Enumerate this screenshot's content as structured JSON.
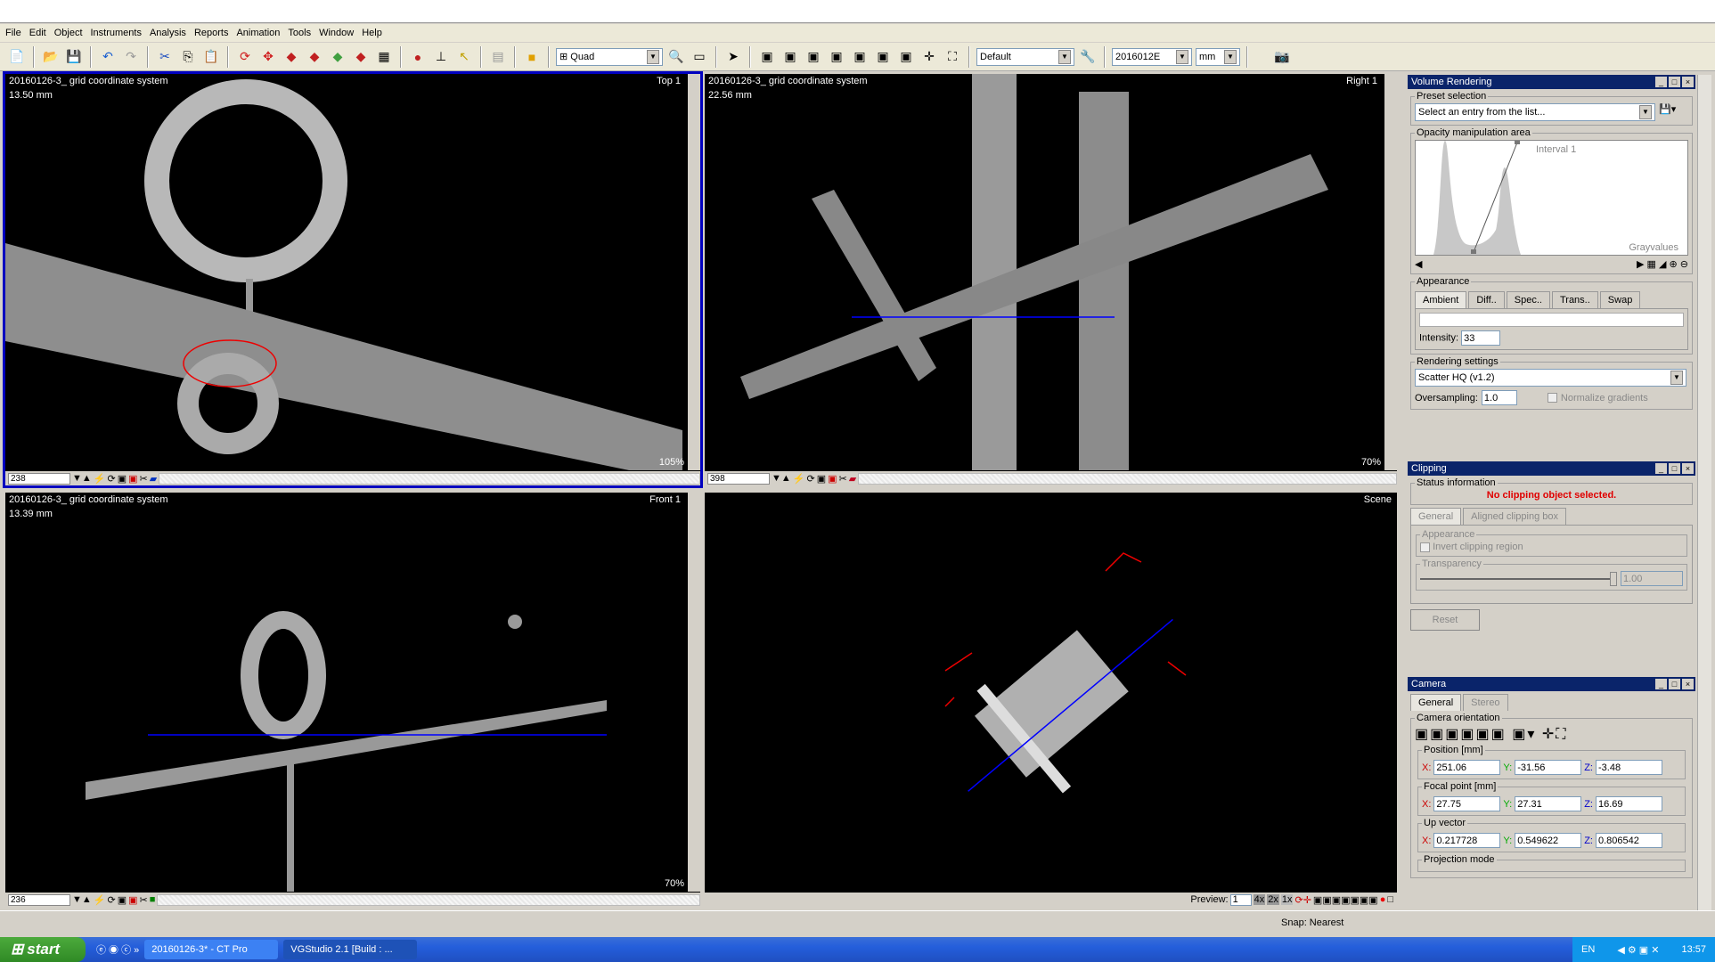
{
  "menu": [
    "File",
    "Edit",
    "Object",
    "Instruments",
    "Analysis",
    "Reports",
    "Animation",
    "Tools",
    "Window",
    "Help"
  ],
  "toolbar": {
    "layout_combo": "Quad",
    "preset_combo": "Default",
    "dataset_combo": "2016012E",
    "unit_combo": "mm"
  },
  "viewports": {
    "top": {
      "title": "20160126-3_ grid coordinate system",
      "scale": "13.50 mm",
      "name": "Top 1",
      "zoom": "105%",
      "slice": "238"
    },
    "right": {
      "title": "20160126-3_ grid coordinate system",
      "scale": "22.56 mm",
      "name": "Right 1",
      "zoom": "70%",
      "slice": "398"
    },
    "front": {
      "title": "20160126-3_ grid coordinate system",
      "scale": "13.39 mm",
      "name": "Front 1",
      "zoom": "70%",
      "slice": "236"
    },
    "scene": {
      "name": "Scene",
      "preview_label": "Preview:",
      "preview_value": "1",
      "scales": [
        "4x",
        "2x",
        "1x"
      ]
    }
  },
  "volume_rendering": {
    "title": "Volume Rendering",
    "preset_label": "Preset selection",
    "preset_placeholder": "Select an entry from the list...",
    "opacity_label": "Opacity manipulation area",
    "interval": "Interval 1",
    "axis": "Grayvalues",
    "appearance_label": "Appearance",
    "tabs": [
      "Ambient",
      "Diff..",
      "Spec..",
      "Trans..",
      "Swap"
    ],
    "intensity_label": "Intensity:",
    "intensity": "33",
    "rendering_label": "Rendering settings",
    "rendering_mode": "Scatter HQ (v1.2)",
    "oversampling_label": "Oversampling:",
    "oversampling": "1.0",
    "normalize_label": "Normalize gradients"
  },
  "clipping": {
    "title": "Clipping",
    "status_label": "Status information",
    "status": "No clipping object selected.",
    "tabs": [
      "General",
      "Aligned clipping box"
    ],
    "appearance_label": "Appearance",
    "invert_label": "Invert clipping region",
    "transparency_label": "Transparency",
    "transparency": "1.00",
    "reset": "Reset"
  },
  "camera": {
    "title": "Camera",
    "tabs": [
      "General",
      "Stereo"
    ],
    "orientation_label": "Camera orientation",
    "position": {
      "label": "Position [mm]",
      "x": "251.06",
      "y": "-31.56",
      "z": "-3.48"
    },
    "focal": {
      "label": "Focal point [mm]",
      "x": "27.75",
      "y": "27.31",
      "z": "16.69"
    },
    "up": {
      "label": "Up vector",
      "x": "0.217728",
      "y": "0.549622",
      "z": "0.806542"
    },
    "projection_label": "Projection mode",
    "axis_labels": {
      "x": "X:",
      "y": "Y:",
      "z": "Z:"
    }
  },
  "status": {
    "snap": "Snap: Nearest"
  },
  "taskbar": {
    "start": "start",
    "tasks": [
      "20160126-3* - CT Pro",
      "VGStudio 2.1  [Build : ..."
    ],
    "lang": "EN",
    "clock": "13:57"
  },
  "colors": {
    "panel_title": "#0a246a",
    "selection": "#0000c0",
    "error": "#e00000",
    "slice_line": "#0000ff"
  }
}
